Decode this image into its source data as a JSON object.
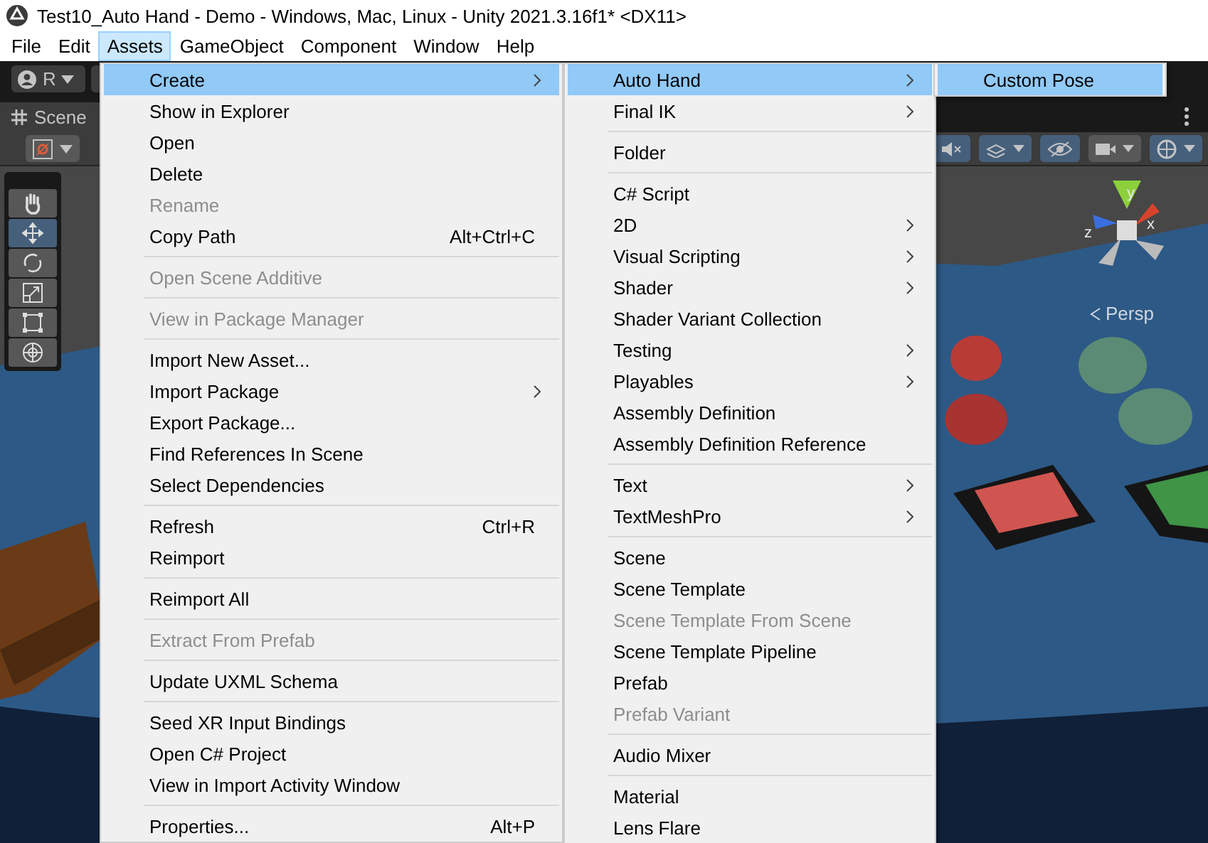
{
  "window": {
    "title": "Test10_Auto Hand - Demo - Windows, Mac, Linux - Unity 2021.3.16f1* <DX11>"
  },
  "menu_bar": [
    {
      "label": "File",
      "selected": false
    },
    {
      "label": "Edit",
      "selected": false
    },
    {
      "label": "Assets",
      "selected": true
    },
    {
      "label": "GameObject",
      "selected": false
    },
    {
      "label": "Component",
      "selected": false
    },
    {
      "label": "Window",
      "selected": false
    },
    {
      "label": "Help",
      "selected": false
    }
  ],
  "toolbar": {
    "account": "R"
  },
  "scene_tab": {
    "label": "Scene"
  },
  "tools": [
    {
      "kind": "hand",
      "selected": false
    },
    {
      "kind": "move",
      "selected": true
    },
    {
      "kind": "rotate",
      "selected": false
    },
    {
      "kind": "scale",
      "selected": false
    },
    {
      "kind": "rect",
      "selected": false
    },
    {
      "kind": "transform",
      "selected": false
    }
  ],
  "scene_toolbar": [
    {
      "kind": "audio",
      "on": true
    },
    {
      "kind": "effects",
      "on": true
    },
    {
      "kind": "visibility",
      "on": true
    },
    {
      "kind": "camera",
      "on": false
    },
    {
      "kind": "gizmos",
      "on": true
    }
  ],
  "scene_view": {
    "projection": "Persp",
    "gizmo_axes": [
      {
        "axis": "y"
      },
      {
        "axis": "x"
      },
      {
        "axis": "z"
      }
    ]
  },
  "menus": [
    {
      "items": [
        {
          "kind": "item",
          "label": "Create",
          "submenu": true,
          "disabled": false,
          "selected": true
        },
        {
          "kind": "item",
          "label": "Show in Explorer",
          "submenu": false,
          "disabled": false,
          "selected": false
        },
        {
          "kind": "item",
          "label": "Open",
          "submenu": false,
          "disabled": false,
          "selected": false
        },
        {
          "kind": "item",
          "label": "Delete",
          "submenu": false,
          "disabled": false,
          "selected": false
        },
        {
          "kind": "item",
          "label": "Rename",
          "submenu": false,
          "disabled": true,
          "selected": false
        },
        {
          "kind": "item",
          "label": "Copy Path",
          "shortcut": "Alt+Ctrl+C",
          "submenu": false,
          "disabled": false,
          "selected": false
        },
        {
          "kind": "separator"
        },
        {
          "kind": "item",
          "label": "Open Scene Additive",
          "submenu": false,
          "disabled": true,
          "selected": false
        },
        {
          "kind": "separator"
        },
        {
          "kind": "item",
          "label": "View in Package Manager",
          "submenu": false,
          "disabled": true,
          "selected": false
        },
        {
          "kind": "separator"
        },
        {
          "kind": "item",
          "label": "Import New Asset...",
          "submenu": false,
          "disabled": false,
          "selected": false
        },
        {
          "kind": "item",
          "label": "Import Package",
          "submenu": true,
          "disabled": false,
          "selected": false
        },
        {
          "kind": "item",
          "label": "Export Package...",
          "submenu": false,
          "disabled": false,
          "selected": false
        },
        {
          "kind": "item",
          "label": "Find References In Scene",
          "submenu": false,
          "disabled": false,
          "selected": false
        },
        {
          "kind": "item",
          "label": "Select Dependencies",
          "submenu": false,
          "disabled": false,
          "selected": false
        },
        {
          "kind": "separator"
        },
        {
          "kind": "item",
          "label": "Refresh",
          "shortcut": "Ctrl+R",
          "submenu": false,
          "disabled": false,
          "selected": false
        },
        {
          "kind": "item",
          "label": "Reimport",
          "submenu": false,
          "disabled": false,
          "selected": false
        },
        {
          "kind": "separator"
        },
        {
          "kind": "item",
          "label": "Reimport All",
          "submenu": false,
          "disabled": false,
          "selected": false
        },
        {
          "kind": "separator"
        },
        {
          "kind": "item",
          "label": "Extract From Prefab",
          "submenu": false,
          "disabled": true,
          "selected": false
        },
        {
          "kind": "separator"
        },
        {
          "kind": "item",
          "label": "Update UXML Schema",
          "submenu": false,
          "disabled": false,
          "selected": false
        },
        {
          "kind": "separator"
        },
        {
          "kind": "item",
          "label": "Seed XR Input Bindings",
          "submenu": false,
          "disabled": false,
          "selected": false
        },
        {
          "kind": "item",
          "label": "Open C# Project",
          "submenu": false,
          "disabled": false,
          "selected": false
        },
        {
          "kind": "item",
          "label": "View in Import Activity Window",
          "submenu": false,
          "disabled": false,
          "selected": false
        },
        {
          "kind": "separator"
        },
        {
          "kind": "item",
          "label": "Properties...",
          "shortcut": "Alt+P",
          "submenu": false,
          "disabled": false,
          "selected": false
        }
      ]
    },
    {
      "items": [
        {
          "kind": "item",
          "label": "Auto Hand",
          "submenu": true,
          "disabled": false,
          "selected": true
        },
        {
          "kind": "item",
          "label": "Final IK",
          "submenu": true,
          "disabled": false,
          "selected": false
        },
        {
          "kind": "separator"
        },
        {
          "kind": "item",
          "label": "Folder",
          "submenu": false,
          "disabled": false,
          "selected": false
        },
        {
          "kind": "separator"
        },
        {
          "kind": "item",
          "label": "C# Script",
          "submenu": false,
          "disabled": false,
          "selected": false
        },
        {
          "kind": "item",
          "label": "2D",
          "submenu": true,
          "disabled": false,
          "selected": false
        },
        {
          "kind": "item",
          "label": "Visual Scripting",
          "submenu": true,
          "disabled": false,
          "selected": false
        },
        {
          "kind": "item",
          "label": "Shader",
          "submenu": true,
          "disabled": false,
          "selected": false
        },
        {
          "kind": "item",
          "label": "Shader Variant Collection",
          "submenu": false,
          "disabled": false,
          "selected": false
        },
        {
          "kind": "item",
          "label": "Testing",
          "submenu": true,
          "disabled": false,
          "selected": false
        },
        {
          "kind": "item",
          "label": "Playables",
          "submenu": true,
          "disabled": false,
          "selected": false
        },
        {
          "kind": "item",
          "label": "Assembly Definition",
          "submenu": false,
          "disabled": false,
          "selected": false
        },
        {
          "kind": "item",
          "label": "Assembly Definition Reference",
          "submenu": false,
          "disabled": false,
          "selected": false
        },
        {
          "kind": "separator"
        },
        {
          "kind": "item",
          "label": "Text",
          "submenu": true,
          "disabled": false,
          "selected": false
        },
        {
          "kind": "item",
          "label": "TextMeshPro",
          "submenu": true,
          "disabled": false,
          "selected": false
        },
        {
          "kind": "separator"
        },
        {
          "kind": "item",
          "label": "Scene",
          "submenu": false,
          "disabled": false,
          "selected": false
        },
        {
          "kind": "item",
          "label": "Scene Template",
          "submenu": false,
          "disabled": false,
          "selected": false
        },
        {
          "kind": "item",
          "label": "Scene Template From Scene",
          "submenu": false,
          "disabled": true,
          "selected": false
        },
        {
          "kind": "item",
          "label": "Scene Template Pipeline",
          "submenu": false,
          "disabled": false,
          "selected": false
        },
        {
          "kind": "item",
          "label": "Prefab",
          "submenu": false,
          "disabled": false,
          "selected": false
        },
        {
          "kind": "item",
          "label": "Prefab Variant",
          "submenu": false,
          "disabled": true,
          "selected": false
        },
        {
          "kind": "separator"
        },
        {
          "kind": "item",
          "label": "Audio Mixer",
          "submenu": false,
          "disabled": false,
          "selected": false
        },
        {
          "kind": "separator"
        },
        {
          "kind": "item",
          "label": "Material",
          "submenu": false,
          "disabled": false,
          "selected": false
        },
        {
          "kind": "item",
          "label": "Lens Flare",
          "submenu": false,
          "disabled": false,
          "selected": false
        }
      ]
    },
    {
      "items": [
        {
          "kind": "item",
          "label": "Custom Pose",
          "submenu": false,
          "disabled": false,
          "selected": true
        }
      ]
    }
  ]
}
